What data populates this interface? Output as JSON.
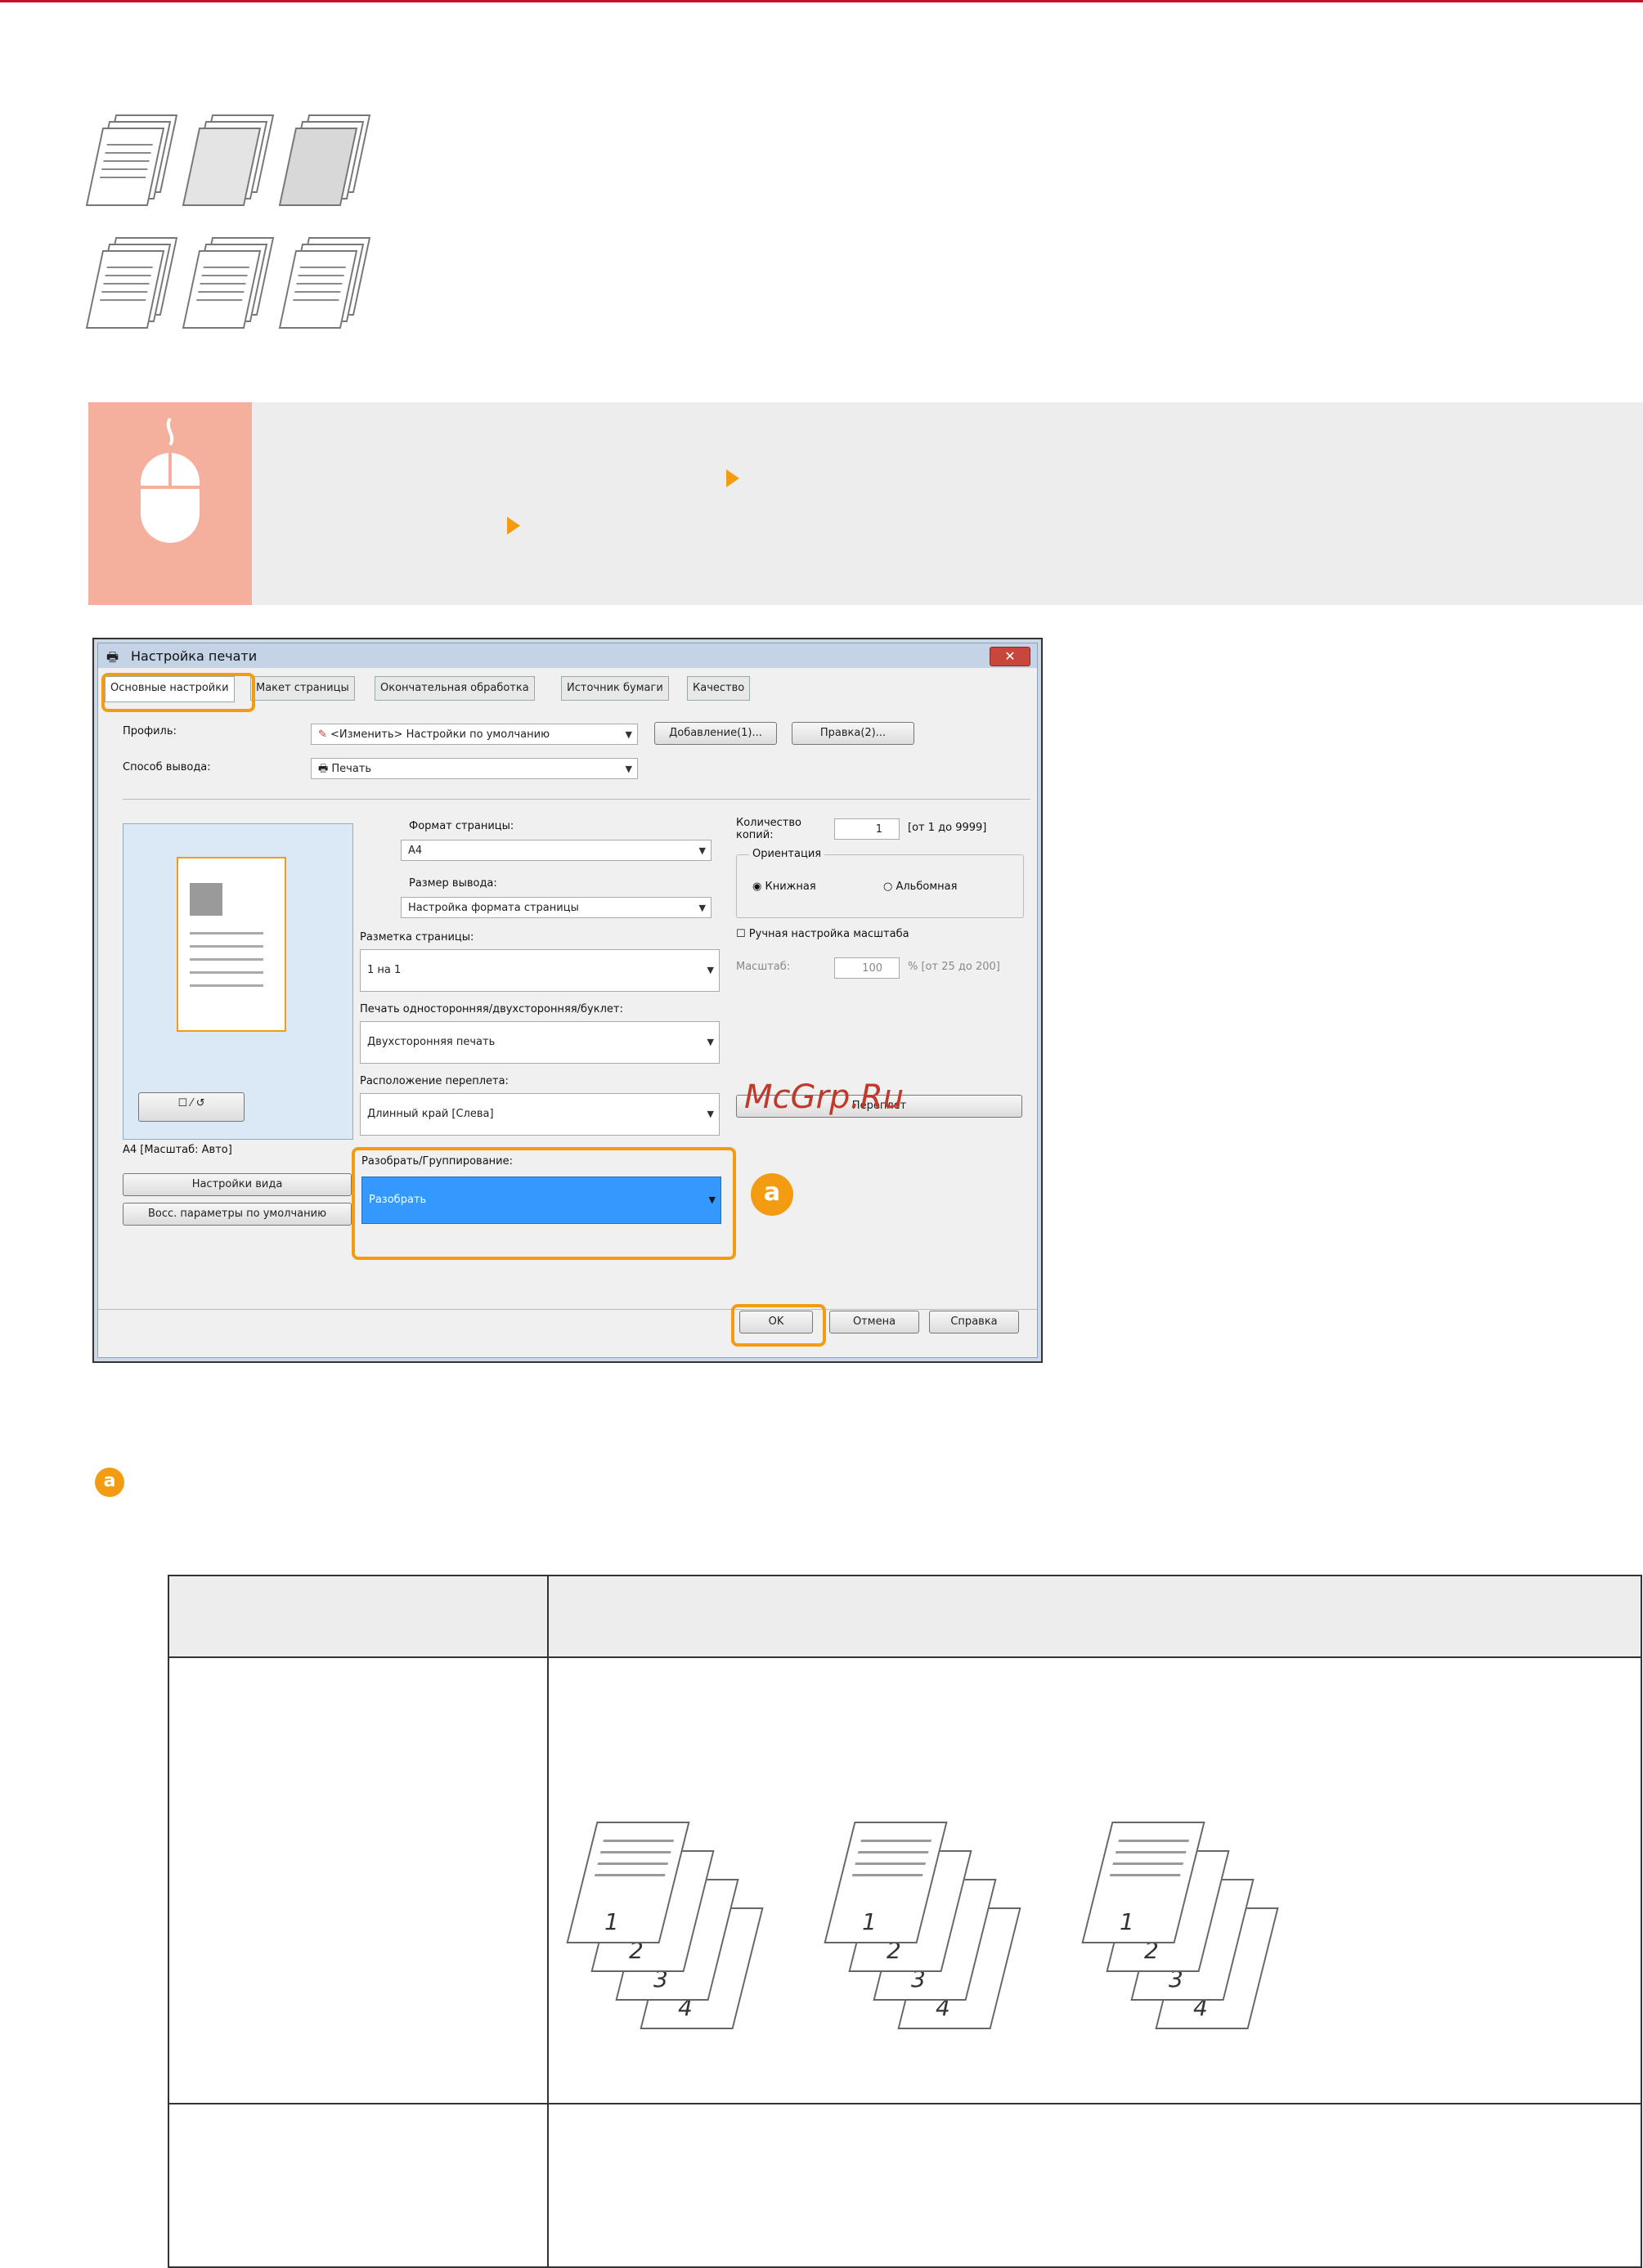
{
  "dialog": {
    "title": "Настройка печати",
    "tabs": [
      "Основные настройки",
      "Макет страницы",
      "Окончательная обработка",
      "Источник бумаги",
      "Качество"
    ],
    "profile_label": "Профиль:",
    "profile_value": "<Изменить> Настройки по умолчанию",
    "add_button": "Добавление(1)...",
    "edit_button": "Правка(2)...",
    "output_method_label": "Способ вывода:",
    "output_method_value": "Печать",
    "page_size_label": "Формат страницы:",
    "page_size_value": "A4",
    "output_size_label": "Размер вывода:",
    "output_size_value": "Настройка формата страницы",
    "layout_label": "Разметка страницы:",
    "layout_value": "1 на 1",
    "duplex_label": "Печать односторонняя/двухсторонняя/буклет:",
    "duplex_value": "Двухсторонняя печать",
    "binding_label": "Расположение переплета:",
    "binding_value": "Длинный край [Слева]",
    "collate_label": "Разобрать/Группирование:",
    "collate_value": "Разобрать",
    "copies_label": "Количество копий:",
    "copies_value": "1",
    "copies_range": "[от 1 до 9999]",
    "orientation_label": "Ориентация",
    "portrait_label": "Книжная",
    "landscape_label": "Альбомная",
    "manual_scale_label": "Ручная настройка масштаба",
    "scale_label": "Масштаб:",
    "scale_value": "100",
    "scale_range": "% [от 25 до 200]",
    "preview_caption": "A4 [Масштаб: Авто]",
    "view_settings_button": "Настройки вида",
    "restore_defaults_button": "Восс. параметры по умолчанию",
    "ok_button": "OK",
    "cancel_button": "Отмена",
    "help_button": "Справка",
    "binding_button_partial": "Переплет"
  },
  "callout_badge": "a",
  "watermark_text": "McGrp.Ru",
  "bottom_table": {
    "fan_page_numbers": [
      "1",
      "2",
      "3",
      "4"
    ]
  },
  "colors": {
    "accent_orange": "#f39c12",
    "top_rule": "#c8102e",
    "banner_bg": "#ededed",
    "mouse_box": "#f4b09c",
    "selected_blue": "#3399ff"
  }
}
